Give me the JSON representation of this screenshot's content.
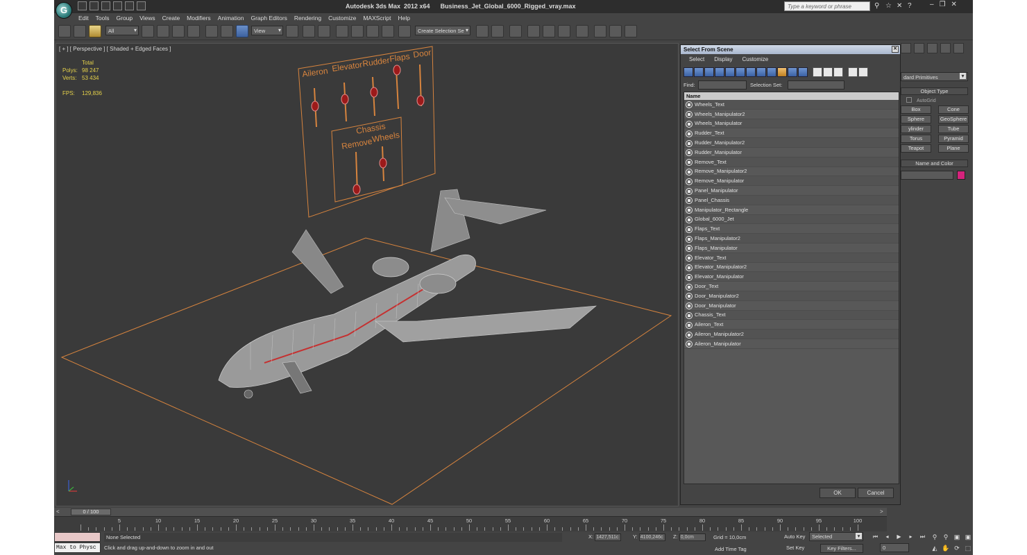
{
  "window": {
    "app_title": "Autodesk 3ds Max  2012 x64      Business_Jet_Global_6000_Rigged_vray.max",
    "search_placeholder": "Type a keyword or phrase"
  },
  "menu": [
    "Edit",
    "Tools",
    "Group",
    "Views",
    "Create",
    "Modifiers",
    "Animation",
    "Graph Editors",
    "Rendering",
    "Customize",
    "MAXScript",
    "Help"
  ],
  "toolbar": {
    "filter_dropdown": "All",
    "refcoord_dropdown": "View",
    "selection_set_dropdown": "Create Selection Se"
  },
  "viewport": {
    "label": "[ + ] [ Perspective ] [ Shaded + Edged Faces ]",
    "stats_header": "Total",
    "polys_label": "Polys:",
    "polys_value": "98 247",
    "verts_label": "Verts:",
    "verts_value": "53 434",
    "fps_label": "FPS:",
    "fps_value": "129,836",
    "panel_labels": {
      "aileron": "Aileron",
      "elevator": "Elevator",
      "rudder": "Rudder",
      "flaps": "Flaps",
      "door": "Door",
      "chassis": "Chassis",
      "remove": "Remove",
      "wheels": "Wheels"
    }
  },
  "command_panel": {
    "category_dropdown": "dard Primitives",
    "object_type_title": "Object Type",
    "autogrid_label": "AutoGrid",
    "primitives": [
      "Box",
      "Cone",
      "Sphere",
      "GeoSphere",
      "ylinder",
      "Tube",
      "Torus",
      "Pyramid",
      "Teapot",
      "Plane"
    ],
    "name_color_title": "Name and Color",
    "color_hex": "#d4237c"
  },
  "dialog": {
    "title": "Select From Scene",
    "menu": [
      "Select",
      "Display",
      "Customize"
    ],
    "find_label": "Find:",
    "selection_set_label": "Selection Set:",
    "column_name": "Name",
    "items": [
      "Wheels_Text",
      "Wheels_Manipulator2",
      "Wheels_Manipulator",
      "Rudder_Text",
      "Rudder_Manipulator2",
      "Rudder_Manipulator",
      "Remove_Text",
      "Remove_Manipulator2",
      "Remove_Manipulator",
      "Panel_Manipulator",
      "Panel_Chassis",
      "Manipulator_Rectangle",
      "Global_6000_Jet",
      "Flaps_Text",
      "Flaps_Manipulator2",
      "Flaps_Manipulator",
      "Elevator_Text",
      "Elevator_Manipulator2",
      "Elevator_Manipulator",
      "Door_Text",
      "Door_Manipulator2",
      "Door_Manipulator",
      "Chassis_Text",
      "Aileron_Text",
      "Aileron_Manipulator2",
      "Aileron_Manipulator"
    ],
    "ok_label": "OK",
    "cancel_label": "Cancel"
  },
  "timeline": {
    "slider_label": "0 / 100",
    "ticks": [
      "5",
      "10",
      "15",
      "20",
      "25",
      "30",
      "35",
      "40",
      "45",
      "50",
      "55",
      "60",
      "65",
      "70",
      "75",
      "80",
      "85",
      "90",
      "95",
      "100"
    ]
  },
  "status": {
    "listener_text": "Max to Physc",
    "selection_status": "None Selected",
    "prompt": "Click and drag up-and-down to zoom in and out",
    "x_label": "X:",
    "x_value": "1427,511c",
    "y_label": "Y:",
    "y_value": "4100,246c",
    "z_label": "Z:",
    "z_value": "0,0cm",
    "grid_label": "Grid = 10,0cm",
    "add_time_tag": "Add Time Tag",
    "auto_key": "Auto Key",
    "set_key": "Set Key",
    "key_mode_dropdown": "Selected",
    "key_filters": "Key Filters...",
    "current_frame": "0"
  },
  "colors": {
    "viewport_bg": "#3a3a3a",
    "accent_orange": "#d7843e",
    "stats_yellow": "#e6d24a",
    "manipulator_red": "#9c1a1a"
  }
}
